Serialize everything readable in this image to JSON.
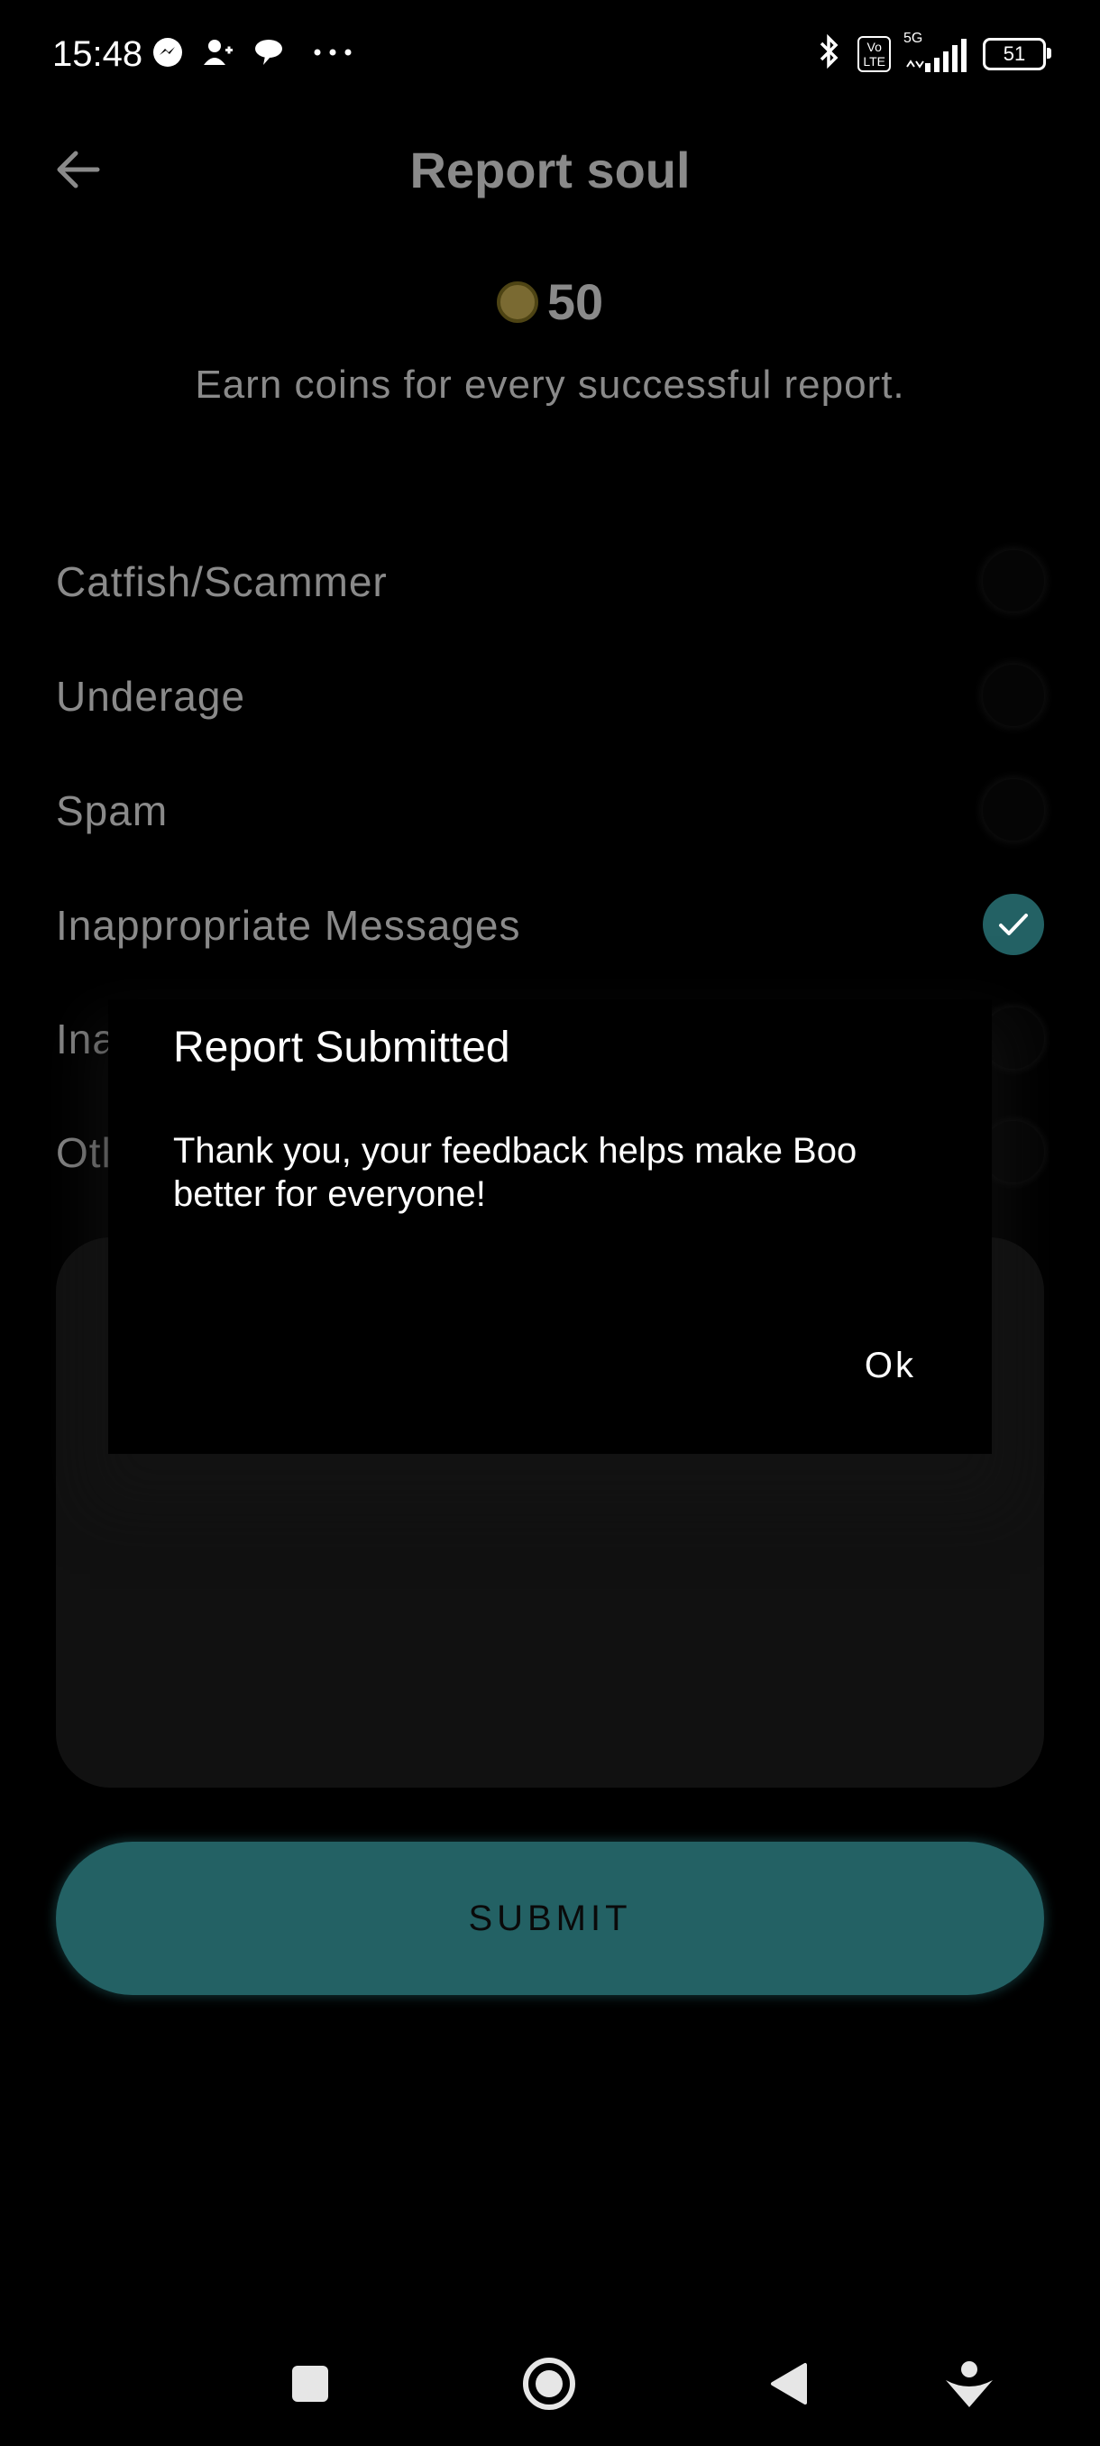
{
  "status_bar": {
    "time": "15:48",
    "left_icons": [
      "messenger-icon",
      "person-add-icon",
      "chat-icon",
      "more-dots-icon"
    ],
    "right_icons": [
      "bluetooth-icon",
      "volte-icon",
      "5g-signal-icon"
    ],
    "volte_label": "Vo\nLTE",
    "network_label": "5G",
    "battery": "51"
  },
  "header": {
    "title": "Report soul",
    "back_icon": "arrow-left-icon"
  },
  "reward": {
    "coins": "50",
    "description": "Earn coins for every successful report."
  },
  "options": [
    {
      "label": "Catfish/Scammer",
      "checked": false
    },
    {
      "label": "Underage",
      "checked": false
    },
    {
      "label": "Spam",
      "checked": false
    },
    {
      "label": "Inappropriate Messages",
      "checked": true
    },
    {
      "label": "Ina",
      "checked": false
    },
    {
      "label": "Otl",
      "checked": false
    }
  ],
  "submit_label": "SUBMIT",
  "dialog": {
    "title": "Report Submitted",
    "message": "Thank you, your feedback helps make Boo better for everyone!",
    "ok_label": "Ok"
  },
  "nav_bar": [
    "square-icon",
    "home-circle-icon",
    "back-triangle-icon",
    "assistant-icon"
  ],
  "colors": {
    "accent": "#236164",
    "background": "#000000",
    "dim_text": "#8a8a8a"
  }
}
